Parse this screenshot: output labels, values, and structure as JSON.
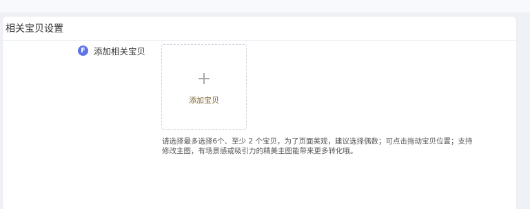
{
  "section": {
    "title": "相关宝贝设置"
  },
  "form": {
    "badge_letter": "F",
    "field_label": "添加相关宝贝",
    "upload": {
      "label": "添加宝贝"
    },
    "hint_line1": "请选择最多选择6个、至少 2 个宝贝，为了页面美观，建议选择偶数；可点击拖动宝贝位置；支持",
    "hint_line2": "修改主图，有场景感或吸引力的精美主图能带来更多转化哦。"
  }
}
